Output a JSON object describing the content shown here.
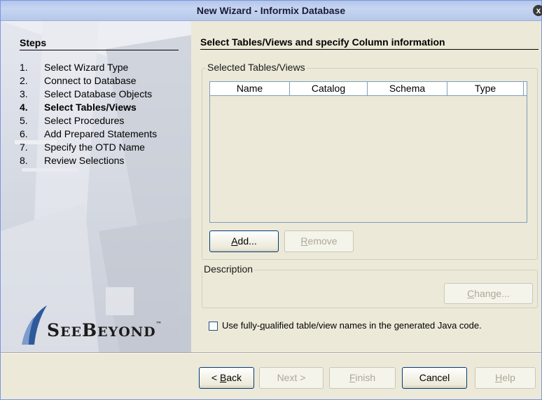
{
  "window": {
    "title": "New Wizard - Informix Database",
    "close_glyph": "x"
  },
  "steps": {
    "heading": "Steps",
    "items": [
      {
        "num": "1.",
        "label": "Select Wizard Type"
      },
      {
        "num": "2.",
        "label": "Connect to Database"
      },
      {
        "num": "3.",
        "label": "Select Database Objects"
      },
      {
        "num": "4.",
        "label": "Select Tables/Views",
        "current": true
      },
      {
        "num": "5.",
        "label": "Select Procedures"
      },
      {
        "num": "6.",
        "label": "Add Prepared Statements"
      },
      {
        "num": "7.",
        "label": "Specify the OTD Name"
      },
      {
        "num": "8.",
        "label": "Review Selections"
      }
    ],
    "logo_text_1": "S",
    "logo_text_2": "EE",
    "logo_text_3": "B",
    "logo_text_4": "EYOND",
    "logo_tm": "™"
  },
  "main": {
    "title": "Select Tables/Views and specify Column information",
    "tables_group_label": "Selected Tables/Views",
    "columns": [
      "Name",
      "Catalog",
      "Schema",
      "Type"
    ],
    "add_button": {
      "underlined": "A",
      "rest": "dd..."
    },
    "remove_button": {
      "underlined": "R",
      "rest": "emove"
    },
    "description_group_label": "Description",
    "change_button": {
      "underlined": "C",
      "rest": "hange..."
    },
    "checkbox_label_pre": "Use fully-",
    "checkbox_label_u": "q",
    "checkbox_label_post": "ualified table/view names in the generated Java code.",
    "checkbox_checked": false
  },
  "footer": {
    "back": {
      "pre": "< ",
      "underlined": "B",
      "rest": "ack"
    },
    "next": "Next >",
    "finish": {
      "underlined": "F",
      "rest": "inish"
    },
    "cancel": "Cancel",
    "help": {
      "underlined": "H",
      "rest": "elp"
    }
  },
  "colors": {
    "accent_border": "#003c74",
    "disabled_text": "#aca899",
    "title_bar": "#c6d5f1"
  }
}
